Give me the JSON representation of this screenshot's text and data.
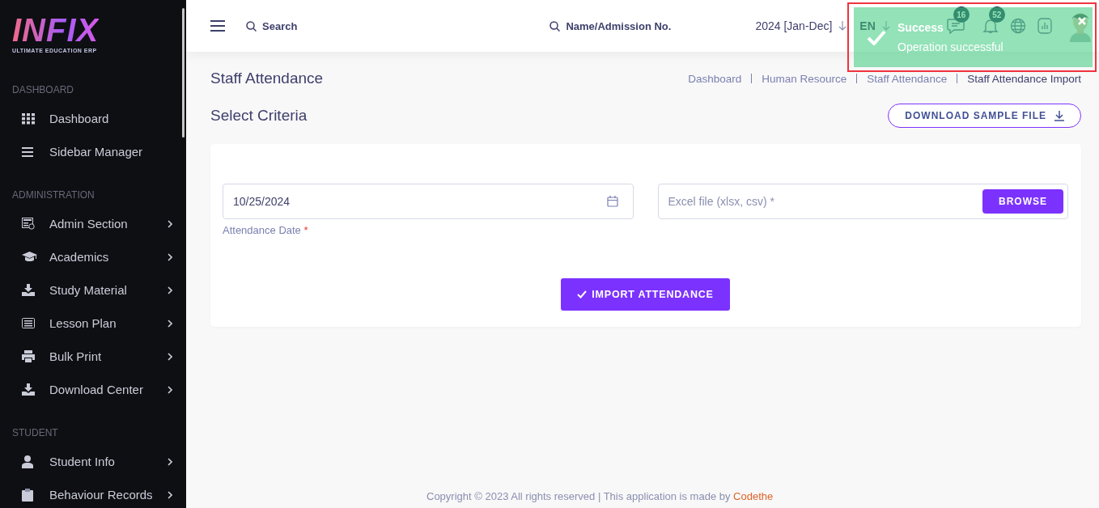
{
  "logo": {
    "text": "INFIX",
    "tagline": "ULTIMATE EDUCATION ERP"
  },
  "sidebar": {
    "sections": [
      {
        "title": "DASHBOARD",
        "items": [
          {
            "label": "Dashboard",
            "kind": "grid",
            "has_submenu": false
          },
          {
            "label": "Sidebar Manager",
            "kind": "bars",
            "has_submenu": false
          }
        ]
      },
      {
        "title": "ADMINISTRATION",
        "items": [
          {
            "label": "Admin Section",
            "kind": "admin",
            "has_submenu": true
          },
          {
            "label": "Academics",
            "kind": "cap",
            "has_submenu": true
          },
          {
            "label": "Study Material",
            "kind": "download",
            "has_submenu": true
          },
          {
            "label": "Lesson Plan",
            "kind": "lesson",
            "has_submenu": true
          },
          {
            "label": "Bulk Print",
            "kind": "print",
            "has_submenu": true
          },
          {
            "label": "Download Center",
            "kind": "download",
            "has_submenu": true
          }
        ]
      },
      {
        "title": "STUDENT",
        "items": [
          {
            "label": "Student Info",
            "kind": "user",
            "has_submenu": true
          },
          {
            "label": "Behaviour Records",
            "kind": "clipboard",
            "has_submenu": true
          }
        ]
      }
    ]
  },
  "header": {
    "search": {
      "placeholder": "Search"
    },
    "student_search": {
      "placeholder": "Name/Admission No."
    },
    "session": "2024 [Jan-Dec]",
    "language": "EN",
    "messages_count": "16",
    "notifications_count": "52"
  },
  "page": {
    "title": "Staff Attendance",
    "breadcrumbs": [
      {
        "label": "Dashboard",
        "current": false
      },
      {
        "label": "Human Resource",
        "current": false
      },
      {
        "label": "Staff Attendance",
        "current": false
      },
      {
        "label": "Staff Attendance Import",
        "current": true
      }
    ],
    "section_title": "Select Criteria",
    "download_button": "DOWNLOAD SAMPLE FILE",
    "form": {
      "date": {
        "value": "10/25/2024",
        "label": "Attendance Date",
        "required_mark": "*"
      },
      "file": {
        "placeholder": "Excel file (xlsx, csv) *",
        "button": "BROWSE"
      },
      "submit": "IMPORT ATTENDANCE"
    }
  },
  "footer": {
    "text": "Copyright © 2023 All rights reserved | This application is made by",
    "link": "Codethe"
  },
  "toast": {
    "title": "Success",
    "message": "Operation successful"
  }
}
